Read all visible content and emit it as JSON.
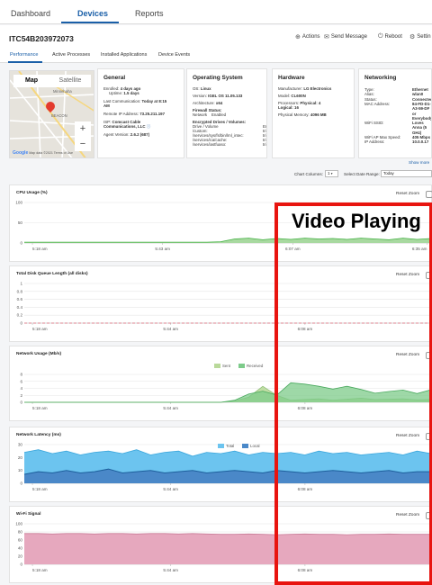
{
  "nav": {
    "tabs": [
      "Dashboard",
      "Devices",
      "Reports"
    ],
    "active_tab": "Devices"
  },
  "device": {
    "id": "ITC54B203972073",
    "actions": {
      "actions": "Actions",
      "send_message": "Send Message",
      "reboot": "Reboot",
      "settings": "Settin"
    }
  },
  "subtabs": [
    "Performance",
    "Active Processes",
    "Installed Applications",
    "Device Events"
  ],
  "map": {
    "map_tab": "Map",
    "satellite_tab": "Satellite",
    "zoom_in": "+",
    "zoom_out": "−",
    "labels": [
      "Minnehaha",
      "BEACON",
      "Google",
      "Map data ©2021",
      "Terms of Use"
    ]
  },
  "general": {
    "title": "General",
    "enrolled": "Enrolled:",
    "enrolled_value": "4 days ago",
    "uptime": "Uptime:",
    "uptime_value": "1.5 days",
    "last_comm": "Last Communication:",
    "last_comm_value": "Today at 8:15",
    "last_comm_suffix": "AM",
    "remote_ip": "Remote IP Address:",
    "remote_ip_value": "73.25.211.197",
    "isp": "ISP:",
    "isp_value": "Comcast Cable",
    "isp_value_2": "Communications, LLC",
    "agent": "Agent Version:",
    "agent_value": "2.6.2 (687)"
  },
  "os": {
    "title": "Operating System",
    "os": "OS:",
    "os_value": "Linux",
    "version": "Version:",
    "version_value": "IGEL OS 11.05.133",
    "arch": "Architecture:",
    "arch_value": "x64",
    "firewall": "Firewall Status:",
    "network": "Network",
    "network_value": "Enabled",
    "encrypted": "Encrypted Drives / Volumes:",
    "drive": "Drive / Volume",
    "drive_col2": "En",
    "paths": [
      "/custom:",
      "/services/sys/fs/bin/lml_intec:",
      "/services/ica/cache:",
      "/services/iastfuaso:"
    ],
    "path_vals": [
      "tri",
      "tri",
      "tri",
      "tri"
    ]
  },
  "hardware": {
    "title": "Hardware",
    "manufacturer": "Manufacturer:",
    "manufacturer_value": "LG Electronics",
    "model": "Model:",
    "model_value": "CL600N",
    "processors": "Processors:",
    "processors_value": "Physical: 4",
    "logical_value": "Logical: 16",
    "memory": "Physical Memory:",
    "memory_value": "4096 MB"
  },
  "networking": {
    "title": "Networking",
    "labels": [
      "Type:",
      "Alias:",
      "Status:",
      "MAC Address:",
      "",
      "",
      "",
      "WiFi SSID:",
      "",
      "",
      "WiFi AP Max Speed:",
      "IP Address:"
    ],
    "values": [
      "Ethernet",
      "wlan0",
      "Connected",
      "84-FD-D1-",
      "A3-59-DF",
      "or",
      "Everybody",
      "Loves",
      "Anna (5",
      "GHz)",
      "405 Mbps",
      "10.0.0.17"
    ],
    "show_more": "Show more"
  },
  "toolbar": {
    "chart_columns_label": "Chart Columns:",
    "chart_columns_value": "1",
    "date_range_label": "Select Date Range:",
    "date_range_value": "Today"
  },
  "overlay": {
    "annotation": "Video Playing"
  },
  "reset_zoom": "Reset Zoom",
  "colors": {
    "cpu_area": "#a8d9a0",
    "cpu_line": "#3fae3f",
    "disk_line": "#e06b7a",
    "sent": "#b9d99a",
    "received": "#7dcb8a",
    "total": "#6cc4ef",
    "local": "#4a88c8",
    "wifi_fill": "#e6a8be",
    "wifi_line": "#c97c98",
    "annotation_border": "#e8140f"
  },
  "chart_data": [
    {
      "type": "area",
      "title": "CPU Usage (%)",
      "ylim": [
        0,
        100
      ],
      "yticks": [
        "100",
        "50",
        "0"
      ],
      "xtick_labels": [
        "5:18 am",
        "5:43 am",
        "6:07 am",
        "6:35 am"
      ],
      "x_range": [
        "5:18 am",
        "6:40 am"
      ],
      "series": [
        {
          "values": [
            2,
            2,
            2,
            2,
            2,
            2,
            2,
            2,
            2,
            2,
            2,
            2,
            2,
            2,
            3,
            10,
            12,
            8,
            11,
            9,
            12,
            10,
            11,
            9,
            12,
            10,
            8,
            12,
            9,
            11
          ]
        }
      ]
    },
    {
      "type": "line",
      "title": "Total Disk Queue Length (all disks)",
      "ylim": [
        0,
        1
      ],
      "yticks": [
        "1",
        "0.8",
        "0.6",
        "0.4",
        "0.2",
        "0"
      ],
      "xtick_labels": [
        "5:18 am",
        "5:44 am",
        "6:08 am"
      ],
      "series": [
        {
          "values": [
            0,
            0,
            0,
            0,
            0,
            0,
            0,
            0,
            0,
            0
          ]
        }
      ]
    },
    {
      "type": "area",
      "title": "Network Usage (Mb/s)",
      "ylim": [
        0,
        8
      ],
      "yticks": [
        "8",
        "6",
        "4",
        "2",
        "0"
      ],
      "xtick_labels": [
        "5:18 am",
        "5:44 am",
        "6:08 am"
      ],
      "series": [
        {
          "name": "Sent",
          "values": [
            0,
            0,
            0,
            0,
            0,
            0,
            0,
            0,
            0,
            0,
            0,
            0,
            0,
            0,
            0,
            0.4,
            1.5,
            4.6,
            2.0,
            0.6,
            0.8,
            1.0,
            0.6,
            0.9,
            1.2,
            0.8,
            0.9,
            1.0,
            0.7,
            0.8
          ]
        },
        {
          "name": "Received",
          "values": [
            0,
            0,
            0,
            0,
            0,
            0,
            0,
            0,
            0,
            0,
            0,
            0,
            0,
            0,
            0,
            0.6,
            2.4,
            3.2,
            2.1,
            5.6,
            5.2,
            4.6,
            3.8,
            4.6,
            3.7,
            2.6,
            3.1,
            3.5,
            2.5,
            3.6
          ]
        }
      ]
    },
    {
      "type": "area",
      "title": "Network Latency (ms)",
      "ylim": [
        0,
        30
      ],
      "yticks": [
        "30",
        "20",
        "10",
        "0"
      ],
      "xtick_labels": [
        "5:18 am",
        "5:44 am",
        "6:08 am"
      ],
      "series": [
        {
          "name": "Total",
          "values": [
            24,
            26,
            23,
            25,
            22,
            24,
            25,
            23,
            26,
            22,
            24,
            25,
            21,
            24,
            23,
            25,
            22,
            24,
            23,
            24,
            22,
            25,
            23,
            24,
            22,
            23,
            24,
            22,
            25,
            23
          ]
        },
        {
          "name": "Local",
          "values": [
            7,
            9,
            8,
            10,
            8,
            9,
            11,
            8,
            9,
            10,
            8,
            9,
            10,
            8,
            9,
            10,
            9,
            8,
            10,
            9,
            8,
            9,
            10,
            9,
            8,
            9,
            10,
            8,
            9,
            9
          ]
        }
      ]
    },
    {
      "type": "area",
      "title": "Wi-Fi Signal",
      "ylim": [
        0,
        100
      ],
      "yticks": [
        "100",
        "80",
        "60",
        "40",
        "20",
        "0"
      ],
      "xtick_labels": [
        "5:18 am",
        "5:44 am",
        "6:08 am"
      ],
      "series": [
        {
          "values": [
            76,
            76,
            75,
            76,
            76,
            75,
            76,
            76,
            75,
            76,
            76,
            75,
            76,
            75,
            74,
            74,
            75,
            74,
            73,
            74,
            75,
            74,
            74,
            73,
            74,
            74,
            75,
            74,
            74,
            74
          ]
        }
      ]
    }
  ]
}
